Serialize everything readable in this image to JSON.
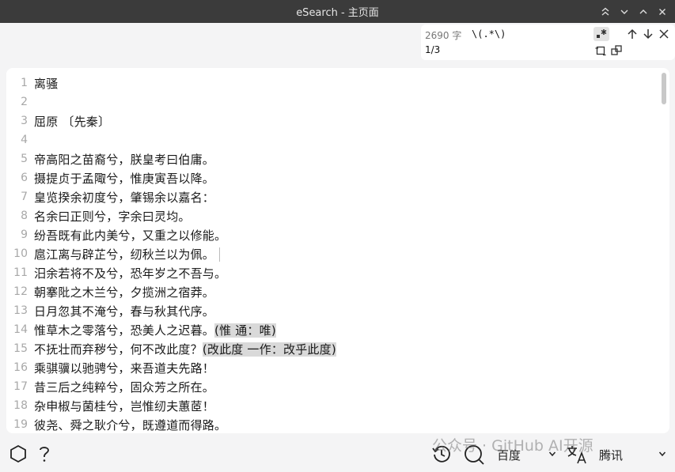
{
  "window": {
    "title": "eSearch - 主页面"
  },
  "find": {
    "count": "2690 字",
    "query": "\\(.*\\)",
    "index": "1/3"
  },
  "editor": {
    "lines": [
      {
        "n": "1",
        "text": "离骚",
        "hl": ""
      },
      {
        "n": "2",
        "text": "",
        "hl": ""
      },
      {
        "n": "3",
        "text": "屈原 〔先秦〕",
        "hl": ""
      },
      {
        "n": "4",
        "text": "",
        "hl": ""
      },
      {
        "n": "5",
        "text": "帝高阳之苗裔兮，朕皇考曰伯庸。",
        "hl": ""
      },
      {
        "n": "6",
        "text": "摄提贞于孟陬兮，惟庚寅吾以降。",
        "hl": ""
      },
      {
        "n": "7",
        "text": "皇览揆余初度兮，肇锡余以嘉名：",
        "hl": ""
      },
      {
        "n": "8",
        "text": "名余曰正则兮，字余曰灵均。",
        "hl": ""
      },
      {
        "n": "9",
        "text": "纷吾既有此内美兮，又重之以修能。",
        "hl": ""
      },
      {
        "n": "10",
        "text": "扈江离与辟芷兮，纫秋兰以为佩。",
        "hl": "",
        "caret": true
      },
      {
        "n": "11",
        "text": "汨余若将不及兮，恐年岁之不吾与。",
        "hl": ""
      },
      {
        "n": "12",
        "text": "朝搴阰之木兰兮，夕揽洲之宿莽。",
        "hl": ""
      },
      {
        "n": "13",
        "text": "日月忽其不淹兮，春与秋其代序。",
        "hl": ""
      },
      {
        "n": "14",
        "text": "惟草木之零落兮，恐美人之迟暮。",
        "hl": "(惟 通：唯)"
      },
      {
        "n": "15",
        "text": "不抚壮而弃秽兮，何不改此度？",
        "hl": "(改此度 一作：改乎此度)"
      },
      {
        "n": "16",
        "text": "乘骐骥以驰骋兮，来吾道夫先路！",
        "hl": ""
      },
      {
        "n": "17",
        "text": "昔三后之纯粹兮，固众芳之所在。",
        "hl": ""
      },
      {
        "n": "18",
        "text": "杂申椒与菌桂兮，岂惟纫夫蕙茝！",
        "hl": ""
      },
      {
        "n": "19",
        "text": "彼尧、舜之耿介兮，既遵道而得路。",
        "hl": ""
      }
    ]
  },
  "bottom": {
    "search_engine": "百度",
    "translate_engine": "腾讯",
    "watermark": "公众号 · GitHub AI开源"
  },
  "icons": {
    "hexagon": "hexagon-icon",
    "help": "help-icon",
    "history": "history-icon",
    "search": "search-icon",
    "translate": "translate-icon"
  }
}
